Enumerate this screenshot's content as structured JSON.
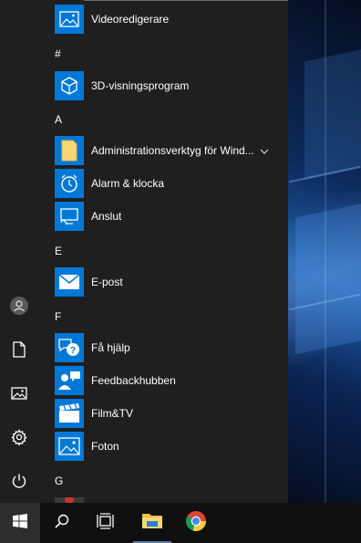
{
  "colors": {
    "menu_bg": "#1f1f1f",
    "tile_blue": "#0078d7",
    "taskbar_bg": "#101010",
    "start_button_active": "#2d2d2d"
  },
  "rail": {
    "items": [
      {
        "icon": "user-icon"
      },
      {
        "icon": "documents-icon"
      },
      {
        "icon": "pictures-icon"
      },
      {
        "icon": "settings-gear-icon"
      },
      {
        "icon": "power-icon"
      }
    ]
  },
  "applist": {
    "sections": [
      {
        "letter": "",
        "apps": [
          {
            "label": "Videoredigerare",
            "icon": "video-editor-icon"
          }
        ]
      },
      {
        "letter": "#",
        "apps": [
          {
            "label": "3D-visningsprogram",
            "icon": "3d-viewer-icon"
          }
        ]
      },
      {
        "letter": "A",
        "apps": [
          {
            "label": "Administrationsverktyg för Wind...",
            "icon": "folder-icon",
            "expandable": true
          },
          {
            "label": "Alarm & klocka",
            "icon": "alarm-clock-icon"
          },
          {
            "label": "Anslut",
            "icon": "connect-icon"
          }
        ]
      },
      {
        "letter": "E",
        "apps": [
          {
            "label": "E-post",
            "icon": "mail-icon"
          }
        ]
      },
      {
        "letter": "F",
        "apps": [
          {
            "label": "Få hjälp",
            "icon": "get-help-icon"
          },
          {
            "label": "Feedbackhubben",
            "icon": "feedback-hub-icon"
          },
          {
            "label": "Film&TV",
            "icon": "film-tv-icon"
          },
          {
            "label": "Foton",
            "icon": "photos-icon"
          }
        ]
      },
      {
        "letter": "G",
        "apps": []
      }
    ]
  },
  "taskbar": {
    "items": [
      {
        "icon": "windows-start-icon"
      },
      {
        "icon": "search-icon"
      },
      {
        "icon": "task-view-icon"
      },
      {
        "icon": "file-explorer-icon"
      },
      {
        "icon": "chrome-icon"
      }
    ]
  }
}
